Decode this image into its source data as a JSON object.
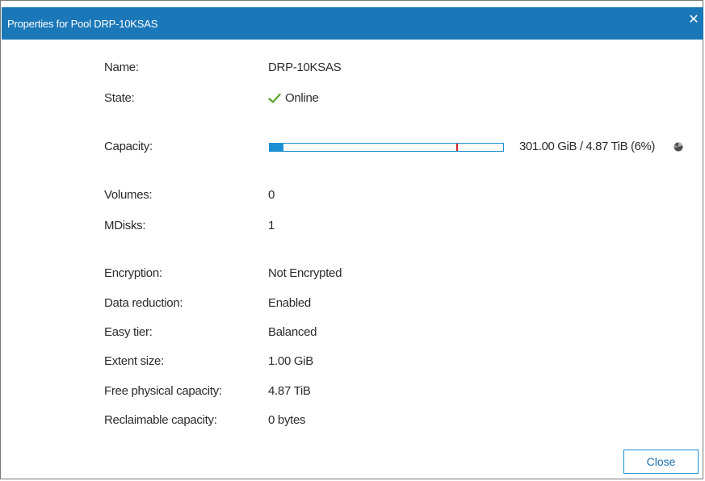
{
  "dialog": {
    "title": "Properties for Pool DRP-10KSAS",
    "close_icon": "close-icon",
    "close_glyph": "✕"
  },
  "properties": {
    "name": {
      "label": "Name:",
      "value": "DRP-10KSAS"
    },
    "state": {
      "label": "State:",
      "value": "Online",
      "icon": "checkmark-icon",
      "icon_color": "#5aa832"
    },
    "capacity": {
      "label": "Capacity:",
      "value": "301.00 GiB / 4.87 TiB (6%)",
      "used_fraction": 0.06,
      "threshold_fraction": 0.8,
      "bar_color": "#1b8fd2",
      "threshold_color": "#d0202a",
      "icon": "pie-chart-icon"
    },
    "volumes": {
      "label": "Volumes:",
      "value": "0"
    },
    "mdisks": {
      "label": "MDisks:",
      "value": "1"
    },
    "encryption": {
      "label": "Encryption:",
      "value": "Not Encrypted"
    },
    "data_reduction": {
      "label": "Data reduction:",
      "value": "Enabled"
    },
    "easy_tier": {
      "label": "Easy tier:",
      "value": "Balanced"
    },
    "extent_size": {
      "label": "Extent size:",
      "value": "1.00 GiB"
    },
    "free_physical_capacity": {
      "label": "Free physical capacity:",
      "value": "4.87 TiB"
    },
    "reclaimable_capacity": {
      "label": "Reclaimable capacity:",
      "value": "0 bytes"
    }
  },
  "footer": {
    "close_label": "Close"
  },
  "colors": {
    "titlebar": "#1b78b8",
    "accent": "#1b8fd2"
  }
}
